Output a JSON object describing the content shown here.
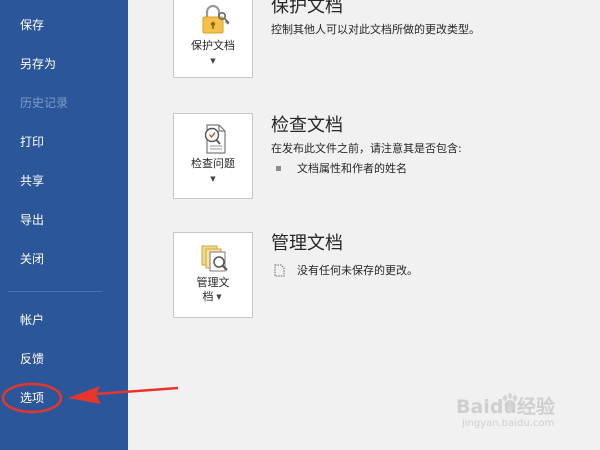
{
  "sidebar": {
    "items": [
      {
        "label": "保存"
      },
      {
        "label": "另存为"
      },
      {
        "label": "历史记录"
      },
      {
        "label": "打印"
      },
      {
        "label": "共享"
      },
      {
        "label": "导出"
      },
      {
        "label": "关闭"
      },
      {
        "label": "帐户"
      },
      {
        "label": "反馈"
      },
      {
        "label": "选项"
      }
    ]
  },
  "sections": {
    "protect": {
      "button_label": "保护文档",
      "title": "保护文档",
      "description": "控制其他人可以对此文档所做的更改类型。"
    },
    "inspect": {
      "button_label": "检查问题",
      "title": "检查文档",
      "description": "在发布此文件之前，请注意其是否包含:",
      "bullets": [
        "文档属性和作者的姓名"
      ]
    },
    "manage": {
      "button_label_line1": "管理文",
      "button_label_line2": "档",
      "title": "管理文档",
      "description": "没有任何未保存的更改。"
    }
  },
  "watermark": {
    "text": "Baidu经验",
    "url": "jingyan.baidu.com"
  },
  "colors": {
    "sidebar_bg": "#2b579a",
    "main_bg": "#f1f1f1",
    "annotation_red": "#e8352b"
  }
}
